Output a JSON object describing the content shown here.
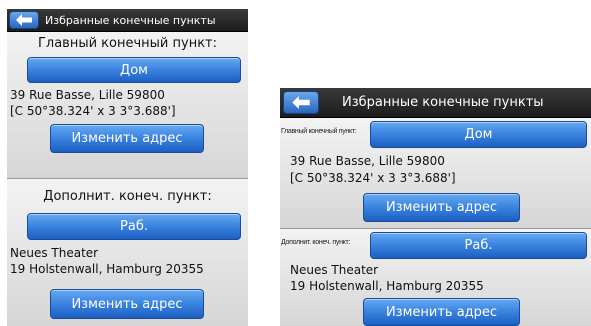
{
  "screens": [
    {
      "title": "Избранные конечные пункты",
      "back_icon": "back-arrow-icon",
      "primary": {
        "heading": "Главный конечный пункт:",
        "button": "Дом",
        "address_line1": "39 Rue Basse, Lille 59800",
        "address_line2": "[C 50°38.324' x 3 3°3.688']",
        "change_button": "Изменить адрес"
      },
      "secondary": {
        "heading": "Дополнит. конеч. пункт:",
        "button": "Раб.",
        "address_line1": "Neues Theater",
        "address_line2": "19 Holstenwall, Hamburg 20355",
        "change_button": "Изменить адрес"
      }
    },
    {
      "title": "Избранные конечные пункты",
      "back_icon": "back-arrow-icon",
      "primary": {
        "heading": "Главный конечный пункт:",
        "button": "Дом",
        "address_line1": "39 Rue Basse, Lille 59800",
        "address_line2": "[C 50°38.324' x 3 3°3.688']",
        "change_button": "Изменить адрес"
      },
      "secondary": {
        "heading": "Дополнит. конеч. пункт:",
        "button": "Раб.",
        "address_line1": "Neues Theater",
        "address_line2": "19 Holstenwall, Hamburg 20355",
        "change_button": "Изменить адрес"
      }
    }
  ],
  "colors": {
    "title_bar": "#1c1c1c",
    "button_blue": "#3d86e0",
    "panel_gray": "#e4e4e4"
  }
}
